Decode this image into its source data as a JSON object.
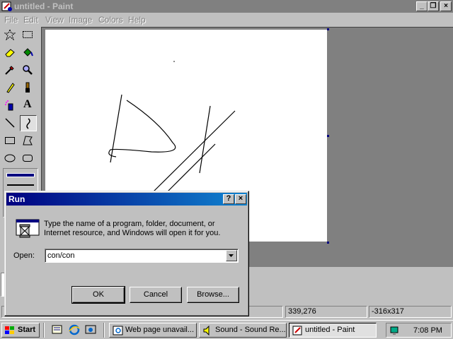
{
  "paint": {
    "title": "untitled - Paint",
    "caption_buttons": {
      "minimize": "_",
      "restore": "❐",
      "close": "×"
    },
    "menu": [
      "File",
      "Edit",
      "View",
      "Image",
      "Colors",
      "Help"
    ],
    "tools": [
      {
        "name": "free-form-select",
        "icon": "star-select-icon"
      },
      {
        "name": "rect-select",
        "icon": "rect-select-icon"
      },
      {
        "name": "eraser",
        "icon": "eraser-icon"
      },
      {
        "name": "fill",
        "icon": "paint-bucket-icon"
      },
      {
        "name": "pick-color",
        "icon": "eyedropper-icon"
      },
      {
        "name": "magnifier",
        "icon": "magnifier-icon"
      },
      {
        "name": "pencil",
        "icon": "pencil-icon"
      },
      {
        "name": "brush",
        "icon": "brush-icon"
      },
      {
        "name": "airbrush",
        "icon": "airbrush-icon"
      },
      {
        "name": "text",
        "icon": "text-icon",
        "glyph": "A"
      },
      {
        "name": "line",
        "icon": "line-icon"
      },
      {
        "name": "curve",
        "icon": "curve-icon"
      },
      {
        "name": "rectangle",
        "icon": "rectangle-icon"
      },
      {
        "name": "polygon",
        "icon": "polygon-icon"
      },
      {
        "name": "ellipse",
        "icon": "ellipse-icon"
      },
      {
        "name": "rounded-rectangle",
        "icon": "rounded-rect-icon"
      }
    ],
    "active_tool": "curve",
    "status": {
      "coords": "339,276",
      "size": "-316x317"
    }
  },
  "run_dialog": {
    "title": "Run",
    "help_button": "?",
    "close_button": "×",
    "description": "Type the name of a program, folder, document, or Internet resource, and Windows will open it for you.",
    "open_label": "Open:",
    "open_value": "con/con",
    "ok_label": "OK",
    "cancel_label": "Cancel",
    "browse_label": "Browse..."
  },
  "taskbar": {
    "start_label": "Start",
    "quick_launch": [
      "show-desktop-icon",
      "internet-explorer-icon",
      "channels-icon"
    ],
    "tasks": [
      {
        "label": "Web page unavail...",
        "icon": "ie-page-icon",
        "active": false
      },
      {
        "label": "Sound - Sound Re...",
        "icon": "sound-recorder-icon",
        "active": false
      },
      {
        "label": "untitled - Paint",
        "icon": "paint-icon",
        "active": true
      }
    ],
    "clock": "7:08 PM"
  },
  "colors": {
    "title_inactive": "#808080",
    "title_active_start": "#000080",
    "title_active_end": "#1084d0",
    "face": "#c0c0c0",
    "canvas": "#ffffff"
  }
}
